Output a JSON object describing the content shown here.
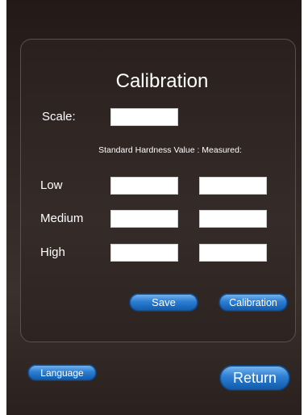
{
  "title": "Calibration",
  "scale": {
    "label": "Scale:",
    "value": ""
  },
  "subheading": "Standard Hardness Value : Measured:",
  "rows": [
    {
      "label": "Low",
      "standard": "",
      "measured": ""
    },
    {
      "label": "Medium",
      "standard": "",
      "measured": ""
    },
    {
      "label": "High",
      "standard": "",
      "measured": ""
    }
  ],
  "buttons": {
    "save": "Save",
    "calibration": "Calibration",
    "language": "Language",
    "return": "Return"
  }
}
